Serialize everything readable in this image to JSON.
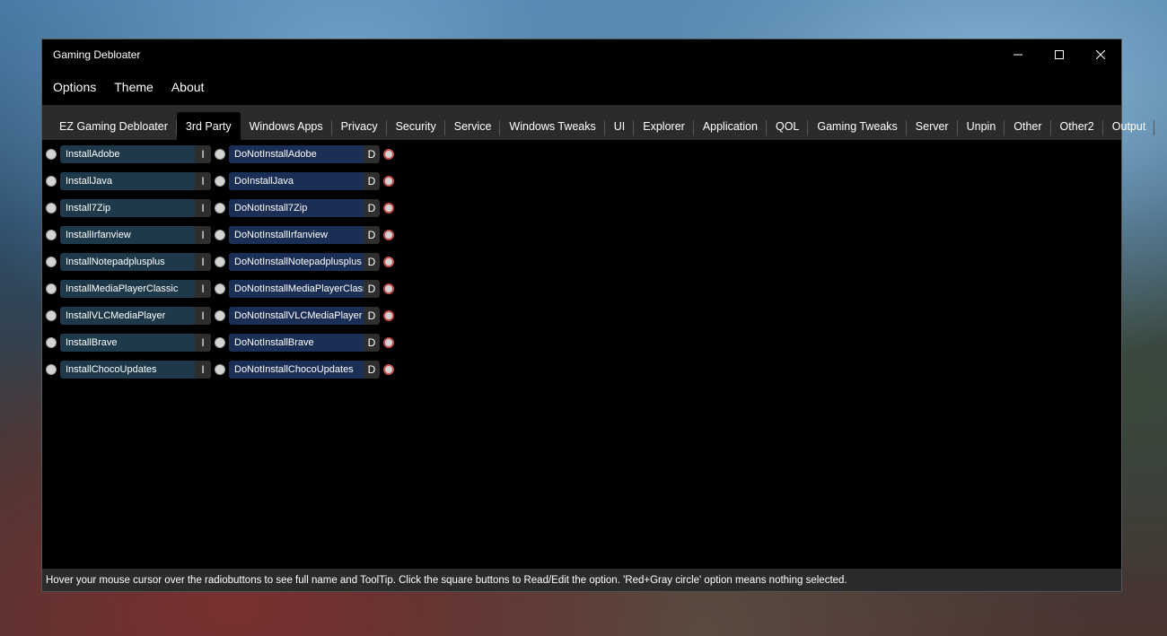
{
  "window": {
    "title": "Gaming Debloater"
  },
  "menu": [
    "Options",
    "Theme",
    "About"
  ],
  "tabs": [
    {
      "label": "EZ Gaming Debloater",
      "active": false
    },
    {
      "label": "3rd Party",
      "active": true
    },
    {
      "label": "Windows Apps",
      "active": false
    },
    {
      "label": "Privacy",
      "active": false
    },
    {
      "label": "Security",
      "active": false
    },
    {
      "label": "Service",
      "active": false
    },
    {
      "label": "Windows Tweaks",
      "active": false
    },
    {
      "label": "UI",
      "active": false
    },
    {
      "label": "Explorer",
      "active": false
    },
    {
      "label": "Application",
      "active": false
    },
    {
      "label": "QOL",
      "active": false
    },
    {
      "label": "Gaming Tweaks",
      "active": false
    },
    {
      "label": "Server",
      "active": false
    },
    {
      "label": "Unpin",
      "active": false
    },
    {
      "label": "Other",
      "active": false
    },
    {
      "label": "Other2",
      "active": false
    },
    {
      "label": "Output",
      "active": false
    }
  ],
  "options": [
    {
      "install": "InstallAdobe",
      "install_btn": "I",
      "dont": "DoNotInstallAdobe",
      "dont_btn": "D"
    },
    {
      "install": "InstallJava",
      "install_btn": "I",
      "dont": "DoInstallJava",
      "dont_btn": "D"
    },
    {
      "install": "Install7Zip",
      "install_btn": "I",
      "dont": "DoNotInstall7Zip",
      "dont_btn": "D"
    },
    {
      "install": "InstallIrfanview",
      "install_btn": "I",
      "dont": "DoNotInstallIrfanview",
      "dont_btn": "D"
    },
    {
      "install": "InstallNotepadplusplus",
      "install_btn": "I",
      "dont": "DoNotInstallNotepadplusplus",
      "dont_btn": "D"
    },
    {
      "install": "InstallMediaPlayerClassic",
      "install_btn": "I",
      "dont": "DoNotInstallMediaPlayerClassic",
      "dont_btn": "D"
    },
    {
      "install": "InstallVLCMediaPlayer",
      "install_btn": "I",
      "dont": "DoNotInstallVLCMediaPlayer",
      "dont_btn": "D"
    },
    {
      "install": "InstallBrave",
      "install_btn": "I",
      "dont": "DoNotInstallBrave",
      "dont_btn": "D"
    },
    {
      "install": "InstallChocoUpdates",
      "install_btn": "I",
      "dont": "DoNotInstallChocoUpdates",
      "dont_btn": "D"
    }
  ],
  "status": "Hover your mouse cursor over the radiobuttons to see full name and ToolTip. Click the square buttons to Read/Edit the option. 'Red+Gray circle' option means nothing selected.",
  "colors": {
    "install_bg": "#1e3a4a",
    "dont_bg": "#1b2f56",
    "unselected_ring": "#c05050"
  },
  "icons": {
    "minimize": "minimize-icon",
    "maximize": "maximize-icon",
    "close": "close-icon"
  }
}
